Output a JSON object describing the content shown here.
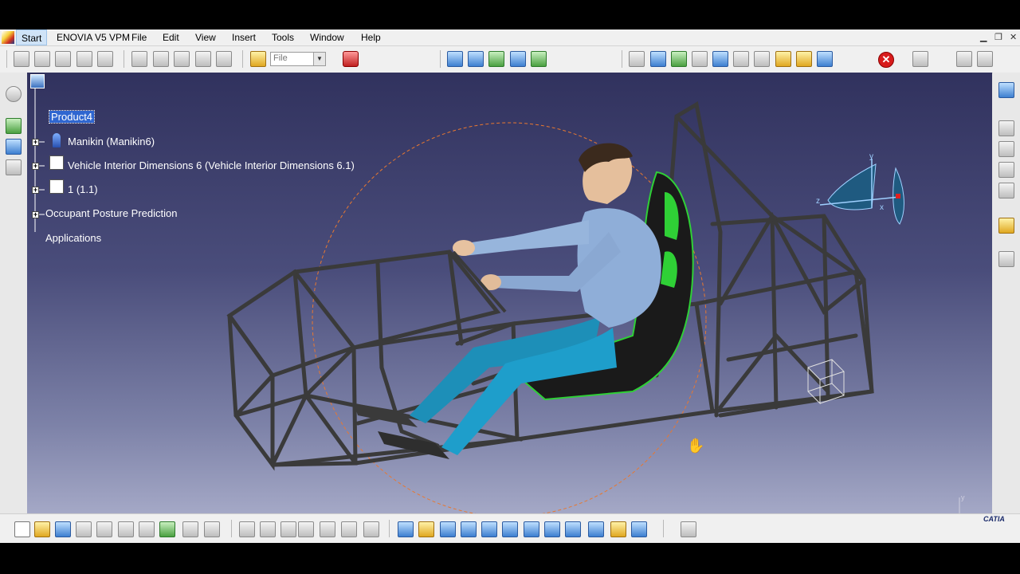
{
  "menubar": {
    "items": [
      "Start",
      "ENOVIA V5 VPM",
      "File",
      "Edit",
      "View",
      "Insert",
      "Tools",
      "Window",
      "Help"
    ]
  },
  "toolbar": {
    "file_combo": "File"
  },
  "tree": {
    "root": "Product4",
    "items": [
      "Manikin (Manikin6)",
      "Vehicle Interior Dimensions 6 (Vehicle Interior Dimensions 6.1)",
      "1 (1.1)",
      "Occupant Posture Prediction",
      "Applications"
    ]
  },
  "compass": {
    "x": "x",
    "y": "y",
    "z": "z"
  },
  "axis_indicator": {
    "x": "x",
    "y": "y",
    "z": "z"
  },
  "brand": {
    "logo_text": "CATIA"
  },
  "colors": {
    "viewport_top": "#31325e",
    "viewport_bottom": "#a4a8c6",
    "selection": "#2f66d0",
    "frame": "#3a3a3a",
    "manikin_shirt": "#8faed8",
    "manikin_pants": "#1d8fb8",
    "seat_accent": "#2fd036"
  },
  "icons": {
    "close": "close-x-icon",
    "compass": "compass-icon",
    "hand_cursor": "hand-cursor-icon"
  }
}
